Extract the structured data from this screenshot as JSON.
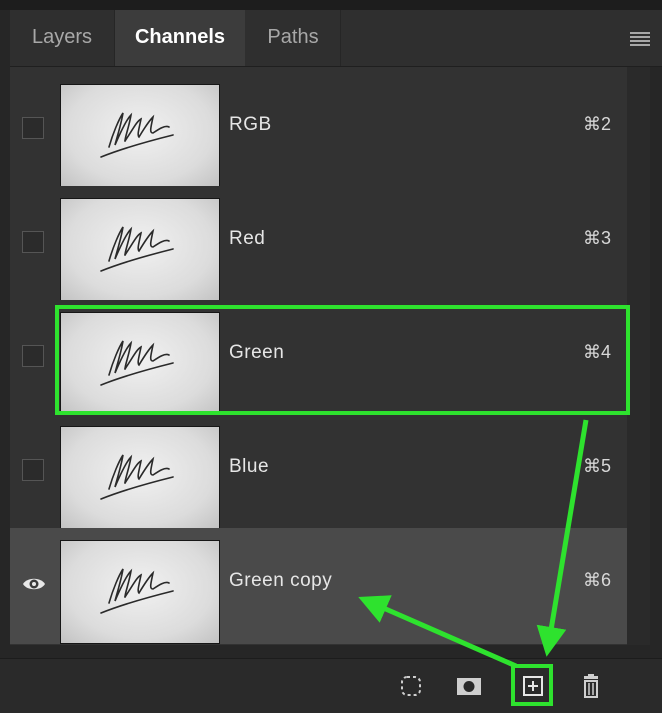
{
  "tabs": [
    {
      "label": "Layers",
      "active": false
    },
    {
      "label": "Channels",
      "active": true
    },
    {
      "label": "Paths",
      "active": false
    }
  ],
  "channels": [
    {
      "name": "RGB",
      "shortcut": "⌘2",
      "visible": false,
      "selected": false
    },
    {
      "name": "Red",
      "shortcut": "⌘3",
      "visible": false,
      "selected": false
    },
    {
      "name": "Green",
      "shortcut": "⌘4",
      "visible": false,
      "selected": false,
      "highlighted": true
    },
    {
      "name": "Blue",
      "shortcut": "⌘5",
      "visible": false,
      "selected": false
    },
    {
      "name": "Green copy",
      "shortcut": "⌘6",
      "visible": true,
      "selected": true
    }
  ],
  "footer_icons": [
    "load-selection-icon",
    "save-selection-mask-icon",
    "new-channel-icon",
    "trash-icon"
  ],
  "annotation_color": "#2ee22e",
  "icons": {
    "panel_menu": "hamburger-menu-icon",
    "visibility": "eye-icon"
  }
}
